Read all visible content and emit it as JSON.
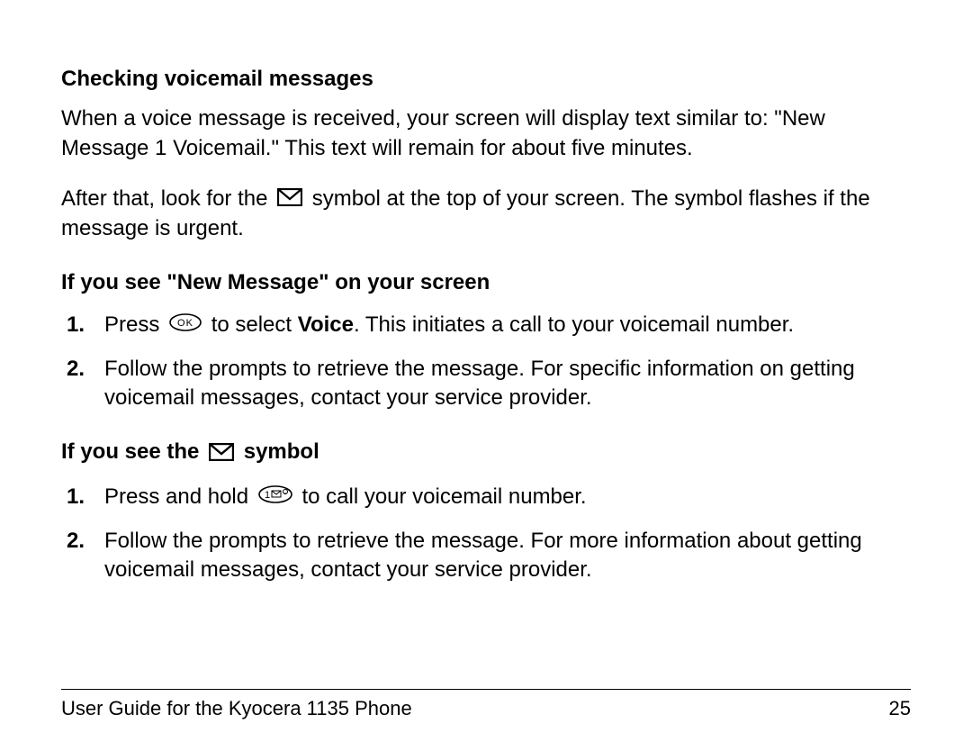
{
  "section": {
    "heading": "Checking voicemail messages",
    "para1": "When a voice message is received, your screen will display text similar to: \"New Message 1 Voicemail.\" This text will remain for about five minutes.",
    "para2a": "After that, look for the ",
    "para2b": " symbol at the top of your screen. The symbol flashes if the message is urgent.",
    "sub1": "If you see \"New Message\" on your screen",
    "sub1_list": {
      "item1a": "Press ",
      "item1b": " to select ",
      "item1c": "Voice",
      "item1d": ". This initiates a call to your voicemail number.",
      "item2": "Follow the prompts to retrieve the message. For specific information on getting voicemail messages, contact your service provider."
    },
    "sub2a": "If you see the ",
    "sub2b": " symbol",
    "sub2_list": {
      "item1a": "Press and hold ",
      "item1b": " to call your voicemail number.",
      "item2": "Follow the prompts to retrieve the message. For more information about getting voicemail messages, contact your service provider."
    }
  },
  "footer": {
    "left": "User Guide for the Kyocera 1135 Phone",
    "right": "25"
  }
}
